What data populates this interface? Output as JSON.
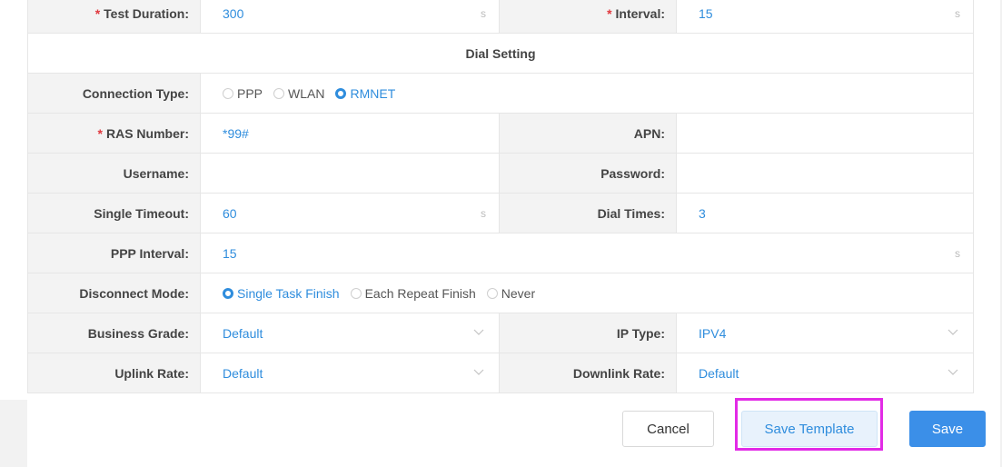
{
  "form": {
    "test_duration": {
      "label": "Test Duration:",
      "required": true,
      "value": "300",
      "unit": "s"
    },
    "interval": {
      "label": "Interval:",
      "required": true,
      "value": "15",
      "unit": "s"
    },
    "section_title": "Dial Setting",
    "connection_type": {
      "label": "Connection Type:",
      "options": [
        "PPP",
        "WLAN",
        "RMNET"
      ],
      "selected": "RMNET"
    },
    "ras_number": {
      "label": "RAS Number:",
      "required": true,
      "value": "*99#"
    },
    "apn": {
      "label": "APN:",
      "value": ""
    },
    "username": {
      "label": "Username:",
      "value": ""
    },
    "password": {
      "label": "Password:",
      "value": ""
    },
    "single_timeout": {
      "label": "Single Timeout:",
      "value": "60",
      "unit": "s"
    },
    "dial_times": {
      "label": "Dial Times:",
      "value": "3"
    },
    "ppp_interval": {
      "label": "PPP Interval:",
      "value": "15",
      "unit": "s"
    },
    "disconnect_mode": {
      "label": "Disconnect Mode:",
      "options": [
        "Single Task Finish",
        "Each Repeat Finish",
        "Never"
      ],
      "selected": "Single Task Finish"
    },
    "business_grade": {
      "label": "Business Grade:",
      "value": "Default"
    },
    "ip_type": {
      "label": "IP Type:",
      "value": "IPV4"
    },
    "uplink_rate": {
      "label": "Uplink Rate:",
      "value": "Default"
    },
    "downlink_rate": {
      "label": "Downlink Rate:",
      "value": "Default"
    }
  },
  "footer": {
    "cancel_label": "Cancel",
    "save_template_label": "Save Template",
    "save_label": "Save"
  },
  "colors": {
    "accent": "#2f8ddd",
    "required": "#e0383e",
    "highlight": "#e22be6"
  }
}
